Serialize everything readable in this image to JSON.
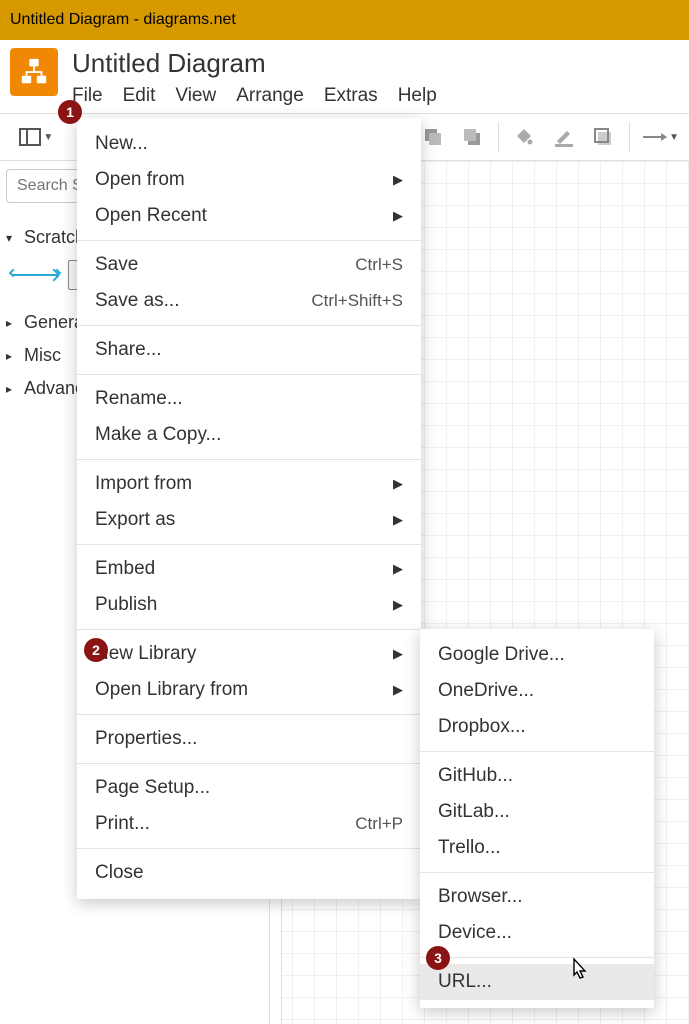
{
  "titlebar": "Untitled Diagram - diagrams.net",
  "doc_title": "Untitled Diagram",
  "menubar": [
    "File",
    "Edit",
    "View",
    "Arrange",
    "Extras",
    "Help"
  ],
  "search_placeholder": "Search Shapes",
  "sidebar_sections": {
    "scratchpad": "Scratchpad",
    "general": "General",
    "misc": "Misc",
    "advanced": "Advanced"
  },
  "file_menu": {
    "new": "New...",
    "open_from": "Open from",
    "open_recent": "Open Recent",
    "save": "Save",
    "save_shortcut": "Ctrl+S",
    "save_as": "Save as...",
    "save_as_shortcut": "Ctrl+Shift+S",
    "share": "Share...",
    "rename": "Rename...",
    "make_copy": "Make a Copy...",
    "import_from": "Import from",
    "export_as": "Export as",
    "embed": "Embed",
    "publish": "Publish",
    "new_library": "New Library",
    "open_library_from": "Open Library from",
    "properties": "Properties...",
    "page_setup": "Page Setup...",
    "print": "Print...",
    "print_shortcut": "Ctrl+P",
    "close": "Close"
  },
  "open_library_submenu": {
    "google_drive": "Google Drive...",
    "onedrive": "OneDrive...",
    "dropbox": "Dropbox...",
    "github": "GitHub...",
    "gitlab": "GitLab...",
    "trello": "Trello...",
    "browser": "Browser...",
    "device": "Device...",
    "url": "URL..."
  },
  "badges": {
    "b1": "1",
    "b2": "2",
    "b3": "3"
  }
}
